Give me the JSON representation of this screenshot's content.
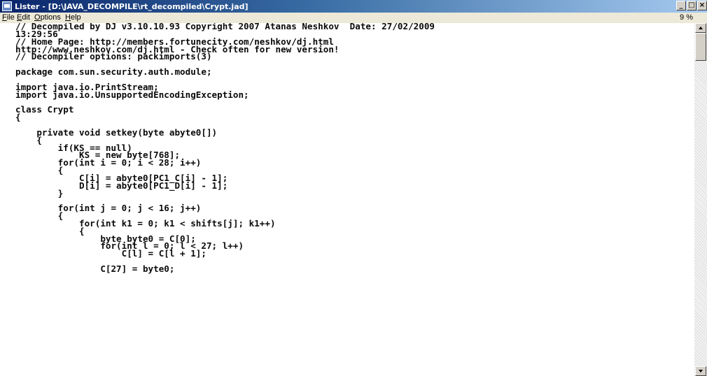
{
  "window": {
    "title": "Lister - [D:\\JAVA_DECOMPILE\\rt_decompiled\\Crypt.jad]",
    "buttons": {
      "minimize": "_",
      "maximize": "□",
      "close": "×"
    }
  },
  "menu": {
    "file": "F",
    "file_rest": "ile",
    "edit": "E",
    "edit_rest": "dit",
    "options": "O",
    "options_rest": "ptions",
    "help": "H",
    "help_rest": "elp",
    "percent": "9 %"
  },
  "code_lines": [
    "// Decompiled by DJ v3.10.10.93 Copyright 2007 Atanas Neshkov  Date: 27/02/2009",
    "13:29:56",
    "// Home Page: http://members.fortunecity.com/neshkov/dj.html",
    "http://www.neshkov.com/dj.html - Check often for new version!",
    "// Decompiler options: packimports(3)",
    "",
    "package com.sun.security.auth.module;",
    "",
    "import java.io.PrintStream;",
    "import java.io.UnsupportedEncodingException;",
    "",
    "class Crypt",
    "{",
    "",
    "    private void setkey(byte abyte0[])",
    "    {",
    "        if(KS == null)",
    "            KS = new byte[768];",
    "        for(int i = 0; i < 28; i++)",
    "        {",
    "            C[i] = abyte0[PC1_C[i] - 1];",
    "            D[i] = abyte0[PC1_D[i] - 1];",
    "        }",
    "",
    "        for(int j = 0; j < 16; j++)",
    "        {",
    "            for(int k1 = 0; k1 < shifts[j]; k1++)",
    "            {",
    "                byte byte0 = C[0];",
    "                for(int l = 0; l < 27; l++)",
    "                    C[l] = C[l + 1];",
    "",
    "                C[27] = byte0;"
  ]
}
